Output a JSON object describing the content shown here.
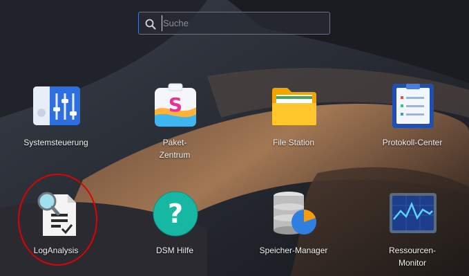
{
  "search": {
    "placeholder": "Suche",
    "value": ""
  },
  "apps": [
    {
      "id": "systemsteuerung",
      "label": "Systemsteuerung",
      "icon": "control-panel-icon"
    },
    {
      "id": "paket-zentrum",
      "label": "Paket-\nZentrum",
      "icon": "package-center-icon"
    },
    {
      "id": "file-station",
      "label": "File Station",
      "icon": "folder-icon"
    },
    {
      "id": "protokoll-center",
      "label": "Protokoll-Center",
      "icon": "log-center-icon"
    },
    {
      "id": "loganalysis",
      "label": "LogAnalysis",
      "icon": "log-analysis-icon"
    },
    {
      "id": "dsm-hilfe",
      "label": "DSM Hilfe",
      "icon": "help-icon"
    },
    {
      "id": "speicher-manager",
      "label": "Speicher-Manager",
      "icon": "storage-manager-icon"
    },
    {
      "id": "ressourcen-monitor",
      "label": "Ressourcen-\nMonitor",
      "icon": "resource-monitor-icon"
    }
  ],
  "annotation": {
    "highlighted_app": "loganalysis",
    "color": "#e00000"
  }
}
